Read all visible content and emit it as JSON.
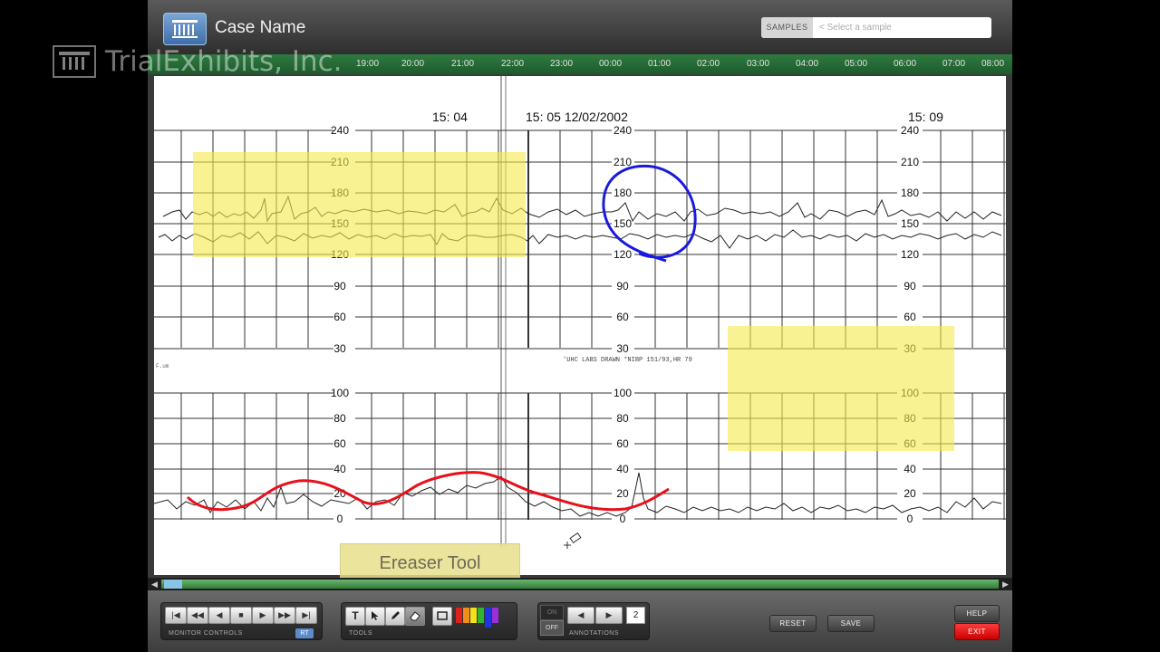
{
  "header": {
    "title": "Case Name",
    "samples_label": "SAMPLES",
    "samples_placeholder": "< Select a sample"
  },
  "watermark": {
    "text": "TrialExhibits, Inc."
  },
  "timeline": {
    "ticks": [
      "19:00",
      "20:00",
      "21:00",
      "22:00",
      "23:00",
      "00:00",
      "01:00",
      "02:00",
      "03:00",
      "04:00",
      "05:00",
      "06:00",
      "07:00",
      "08:00"
    ]
  },
  "document": {
    "time_labels": [
      "15: 04",
      "15: 05  12/02/2002",
      "15: 09"
    ],
    "upper_scale": [
      "240",
      "210",
      "180",
      "150",
      "120",
      "90",
      "60",
      "30"
    ],
    "lower_scale": [
      "100",
      "80",
      "60",
      "40",
      "20",
      "0"
    ],
    "annotation_text": "'UHC LABS DRAWN *NIBP  151/93,HR 79",
    "side_mark": "F.um"
  },
  "tooltip": {
    "text": "Ereaser Tool"
  },
  "monitor_controls": {
    "label": "MONITOR CONTROLS",
    "rt_badge": "RT",
    "buttons": [
      "|◀",
      "◀◀",
      "◀",
      "■",
      "▶",
      "▶▶",
      "▶|"
    ]
  },
  "tools": {
    "label": "TOOLS",
    "text_tool": "T",
    "colors": [
      "#e0201a",
      "#f28c1a",
      "#f2e21a",
      "#2fb52f",
      "#1a37e0",
      "#9b2fd6"
    ]
  },
  "annotations": {
    "label": "ANNOTATIONS",
    "on_label": "ON",
    "off_label": "OFF",
    "page": "2"
  },
  "actions": {
    "reset": "RESET",
    "save": "SAVE",
    "help": "HELP",
    "exit": "EXIT"
  },
  "icons": {
    "app": "building-columns-icon",
    "tools": [
      "text-icon",
      "pointer-icon",
      "pen-icon",
      "eraser-icon",
      "rectangle-icon"
    ]
  }
}
